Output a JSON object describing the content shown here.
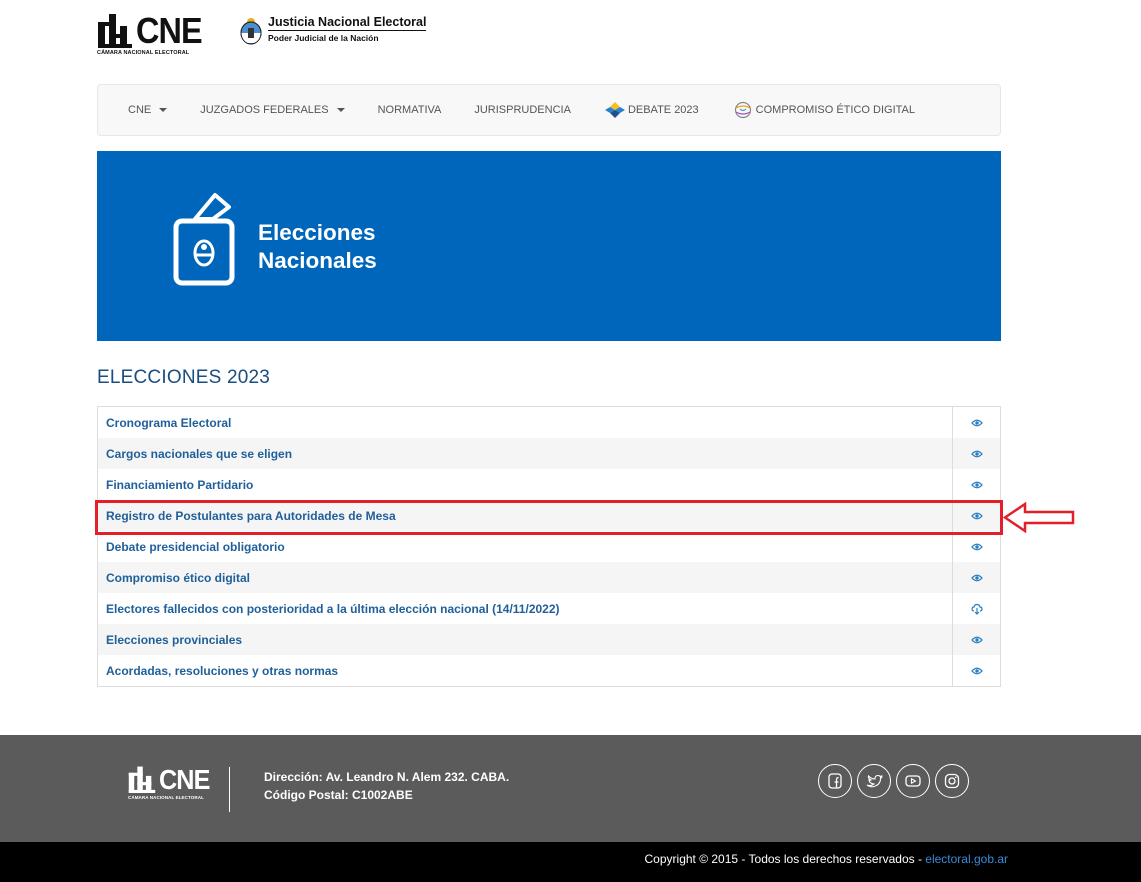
{
  "header": {
    "cne_word": "CNE",
    "cne_sub": "CÁMARA NACIONAL ELECTORAL",
    "jne_title": "Justicia Nacional Electoral",
    "jne_sub": "Poder Judicial de la Nación"
  },
  "nav": {
    "items": [
      {
        "label": "CNE"
      },
      {
        "label": "JUZGADOS FEDERALES"
      },
      {
        "label": "NORMATIVA"
      },
      {
        "label": "JURISPRUDENCIA"
      },
      {
        "label": "DEBATE 2023"
      },
      {
        "label": "COMPROMISO ÉTICO DIGITAL"
      }
    ]
  },
  "banner": {
    "line1": "Elecciones",
    "line2": "Nacionales"
  },
  "section": {
    "title": "ELECCIONES 2023"
  },
  "list": {
    "rows": [
      {
        "label": "Cronograma Electoral",
        "icon": "eye-icon"
      },
      {
        "label": "Cargos nacionales que se eligen",
        "icon": "eye-icon"
      },
      {
        "label": "Financiamiento Partidario",
        "icon": "eye-icon"
      },
      {
        "label": "Registro de Postulantes para Autoridades de Mesa",
        "icon": "eye-icon"
      },
      {
        "label": "Debate presidencial obligatorio",
        "icon": "eye-icon"
      },
      {
        "label": "Compromiso ético digital",
        "icon": "eye-icon"
      },
      {
        "label": "Electores fallecidos con posterioridad a la última elección nacional (14/11/2022)",
        "icon": "cloud-download-icon"
      },
      {
        "label": "Elecciones provinciales",
        "icon": "eye-icon"
      },
      {
        "label": "Acordadas, resoluciones y otras normas",
        "icon": "eye-icon"
      }
    ]
  },
  "footer": {
    "cne_word": "CNE",
    "cne_sub": "CÁMARA NACIONAL ELECTORAL",
    "address": "Dirección: Av. Leandro N. Alem 232. CABA.",
    "postal": "Código Postal: C1002ABE",
    "socials": [
      "facebook-icon",
      "twitter-icon",
      "youtube-icon",
      "instagram-icon"
    ],
    "copyright": "Copyright © 2015 - Todos los derechos reservados - ",
    "copyright_link": "electoral.gob.ar"
  },
  "colors": {
    "banner": "#0066bb",
    "link": "#1f5f9a",
    "highlight": "#e3202a",
    "footer": "#5b5b5b"
  }
}
